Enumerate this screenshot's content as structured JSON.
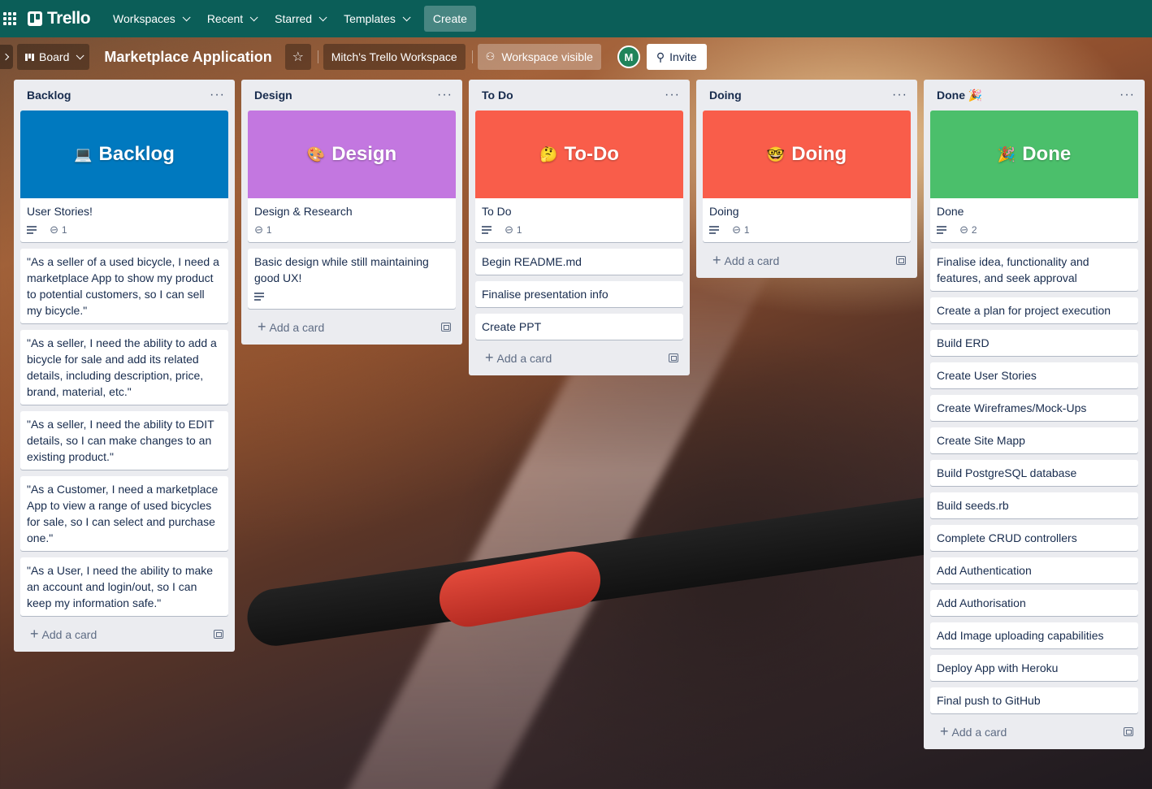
{
  "nav": {
    "logo": "Trello",
    "items": [
      "Workspaces",
      "Recent",
      "Starred",
      "Templates"
    ],
    "create_label": "Create"
  },
  "board": {
    "view_label": "Board",
    "title": "Marketplace Application",
    "workspace": "Mitch's Trello Workspace",
    "visibility": "Workspace visible",
    "avatar_initial": "M",
    "invite_label": "Invite"
  },
  "add_card_label": "Add a card",
  "lists": [
    {
      "title": "Backlog",
      "cover": {
        "emoji": "💻",
        "text": "Backlog",
        "color": "#0079bf"
      },
      "cover_card": {
        "text": "User Stories!",
        "has_desc": true,
        "attachments": "1"
      },
      "cards": [
        "\"As a seller of a used bicycle, I need a marketplace App to show my product to potential customers, so I can sell my bicycle.\"",
        "\"As a seller, I need the ability to add a bicycle for sale and add its related details, including description, price, brand, material, etc.\"",
        "\"As a seller, I need the ability to EDIT details, so I can make changes to an existing product.\"",
        "\"As a Customer, I need a marketplace App to view a range of used bicycles for sale, so I can select and purchase one.\"",
        "\"As a User, I need the ability to make an account and login/out, so I can keep my information safe.\""
      ]
    },
    {
      "title": "Design",
      "cover": {
        "emoji": "🎨",
        "text": "Design",
        "color": "#c377e0"
      },
      "cover_card": {
        "text": "Design & Research",
        "has_desc": false,
        "attachments": "1"
      },
      "cards": [
        "Basic design while still maintaining good UX!"
      ]
    },
    {
      "title": "To Do",
      "cover": {
        "emoji": "🤔",
        "text": "To-Do",
        "color": "#f95d4a"
      },
      "cover_card": {
        "text": "To Do",
        "has_desc": true,
        "attachments": "1"
      },
      "cards": [
        "Begin README.md",
        "Finalise presentation info",
        "Create PPT"
      ]
    },
    {
      "title": "Doing",
      "cover": {
        "emoji": "🤓",
        "text": "Doing",
        "color": "#f95d4a"
      },
      "cover_card": {
        "text": "Doing",
        "has_desc": true,
        "attachments": "1"
      },
      "cards": []
    },
    {
      "title": "Done 🎉",
      "cover": {
        "emoji": "🎉",
        "text": "Done",
        "color": "#4bbf6b"
      },
      "cover_card": {
        "text": "Done",
        "has_desc": true,
        "attachments": "2"
      },
      "cards": [
        "Finalise idea, functionality and features, and seek approval",
        "Create a plan for project execution",
        "Build ERD",
        "Create User Stories",
        "Create Wireframes/Mock-Ups",
        "Create Site Mapp",
        "Build PostgreSQL database",
        "Build seeds.rb",
        "Complete CRUD controllers",
        "Add Authentication",
        "Add Authorisation",
        "Add Image uploading capabilities",
        "Deploy App with Heroku",
        "Final push to GitHub"
      ]
    }
  ]
}
